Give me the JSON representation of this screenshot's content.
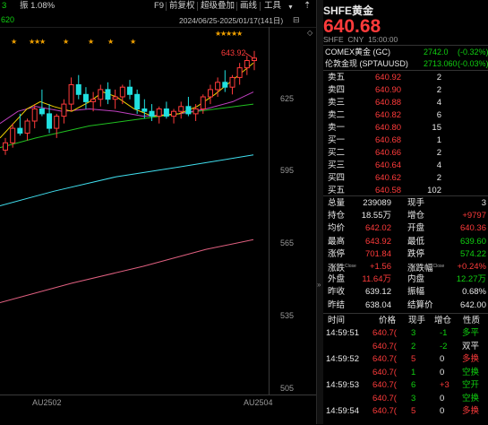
{
  "topbar": {
    "left_value": "3",
    "amplitude": "振 1.08%",
    "period_label": "F9",
    "menu": [
      "前复权",
      "超级叠加",
      "画线",
      "工具"
    ],
    "ma_value": "620",
    "date_range": "2024/06/25-2025/01/17(141日)",
    "high_marker": "643.92"
  },
  "chart_data": {
    "type": "candlestick",
    "y_ticks": [
      "625",
      "595",
      "565",
      "535",
      "505"
    ],
    "x_ticks": [
      "AU2502",
      "AU2504"
    ],
    "high_annotation": "643.92",
    "ylim": [
      500,
      650
    ]
  },
  "instrument": {
    "name": "SHFE黄金",
    "price": "640.68",
    "exchange": "SHFE",
    "currency": "CNY",
    "time": "15:00:00"
  },
  "related": [
    {
      "name": "COMEX黄金 (GC)",
      "value": "2742.0",
      "change": "(-0.32%)"
    },
    {
      "name": "伦敦金现 (SPTAUUSD)",
      "value": "2713.060",
      "change": "(-0.03%)"
    }
  ],
  "asks": [
    {
      "label": "卖五",
      "price": "640.92",
      "vol": "2"
    },
    {
      "label": "卖四",
      "price": "640.90",
      "vol": "2"
    },
    {
      "label": "卖三",
      "price": "640.88",
      "vol": "4"
    },
    {
      "label": "卖二",
      "price": "640.82",
      "vol": "6"
    },
    {
      "label": "卖一",
      "price": "640.80",
      "vol": "15"
    }
  ],
  "bids": [
    {
      "label": "买一",
      "price": "640.68",
      "vol": "1"
    },
    {
      "label": "买二",
      "price": "640.66",
      "vol": "2"
    },
    {
      "label": "买三",
      "price": "640.64",
      "vol": "4"
    },
    {
      "label": "买四",
      "price": "640.62",
      "vol": "2"
    },
    {
      "label": "买五",
      "price": "640.58",
      "vol": "102"
    }
  ],
  "stats": [
    {
      "l1": "总量",
      "v1": "239089",
      "c1": "white",
      "l2": "现手",
      "v2": "3",
      "c2": "white"
    },
    {
      "l1": "持仓",
      "v1": "18.55万",
      "c1": "white",
      "l2": "增仓",
      "v2": "+9797",
      "c2": "red"
    },
    {
      "l1": "均价",
      "v1": "642.02",
      "c1": "red",
      "l2": "开盘",
      "v2": "640.36",
      "c2": "red"
    },
    {
      "l1": "最高",
      "v1": "643.92",
      "c1": "red",
      "l2": "最低",
      "v2": "639.60",
      "c2": "green"
    },
    {
      "l1": "涨停",
      "v1": "701.84",
      "c1": "red",
      "l2": "跌停",
      "v2": "574.22",
      "c2": "green"
    },
    {
      "l1": "涨跌",
      "sup1": "Close",
      "v1": "+1.56",
      "c1": "red",
      "l2": "涨跌幅",
      "sup2": "Close",
      "v2": "+0.24%",
      "c2": "red"
    },
    {
      "l1": "外盘",
      "v1": "11.64万",
      "c1": "red",
      "l2": "内盘",
      "v2": "12.27万",
      "c2": "green"
    },
    {
      "l1": "昨收",
      "v1": "639.12",
      "c1": "white",
      "l2": "振幅",
      "v2": "0.68%",
      "c2": "white"
    },
    {
      "l1": "昨结",
      "v1": "638.04",
      "c1": "white",
      "l2": "结算价",
      "v2": "642.00",
      "c2": "white"
    }
  ],
  "ticks_header": [
    "时间",
    "价格",
    "现手",
    "增仓",
    "性质"
  ],
  "ticks": [
    {
      "time": "14:59:51",
      "price": "640.7(",
      "vol": "3",
      "vc": "green",
      "oi": "-1",
      "oc": "green",
      "nature": "多平",
      "nc": "green"
    },
    {
      "time": "",
      "price": "640.7(",
      "vol": "2",
      "vc": "green",
      "oi": "-2",
      "oc": "green",
      "nature": "双平",
      "nc": "white"
    },
    {
      "time": "14:59:52",
      "price": "640.7(",
      "vol": "5",
      "vc": "red",
      "oi": "0",
      "oc": "white",
      "nature": "多换",
      "nc": "red"
    },
    {
      "time": "",
      "price": "640.7(",
      "vol": "1",
      "vc": "green",
      "oi": "0",
      "oc": "white",
      "nature": "空换",
      "nc": "green"
    },
    {
      "time": "14:59:53",
      "price": "640.7(",
      "vol": "6",
      "vc": "green",
      "oi": "+3",
      "oc": "red",
      "nature": "空开",
      "nc": "green"
    },
    {
      "time": "",
      "price": "640.7(",
      "vol": "3",
      "vc": "green",
      "oi": "0",
      "oc": "white",
      "nature": "空换",
      "nc": "green"
    },
    {
      "time": "14:59:54",
      "price": "640.7(",
      "vol": "5",
      "vc": "red",
      "oi": "0",
      "oc": "white",
      "nature": "多换",
      "nc": "red"
    }
  ]
}
